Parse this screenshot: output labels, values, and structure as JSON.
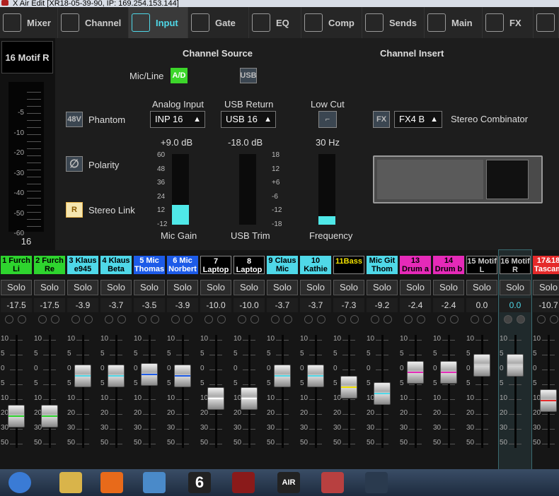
{
  "window": {
    "title": "X Air Edit [XR18-05-39-90, IP: 169.254.153.144]"
  },
  "tabs": [
    {
      "label": "Mixer",
      "icon": "mixer-icon"
    },
    {
      "label": "Channel",
      "icon": "channel-icon"
    },
    {
      "label": "Input",
      "icon": "input-icon",
      "active": true
    },
    {
      "label": "Gate",
      "icon": "gate-icon"
    },
    {
      "label": "EQ",
      "icon": "eq-icon"
    },
    {
      "label": "Comp",
      "icon": "comp-icon"
    },
    {
      "label": "Sends",
      "icon": "sends-icon"
    },
    {
      "label": "Main",
      "icon": "main-icon"
    },
    {
      "label": "FX",
      "icon": "fx-icon"
    },
    {
      "label": "",
      "icon": "more-icon"
    }
  ],
  "channel": {
    "name": "16  Motif R",
    "meter_number": "16",
    "meter_scale": [
      "-5",
      "-10",
      "-20",
      "-30",
      "-40",
      "-50",
      "-60"
    ]
  },
  "source": {
    "header": "Channel Source",
    "insert_header": "Channel Insert",
    "micline_label": "Mic/Line",
    "ad_label": "A/D",
    "usb_label": "USB",
    "phantom_btn": "48V",
    "phantom_label": "Phantom",
    "polarity_icon": "polarity-icon",
    "polarity_label": "Polarity",
    "stereolink_btn": "R",
    "stereolink_label": "Stereo Link",
    "analog_label": "Analog Input",
    "analog_value": "INP 16",
    "usbreturn_label": "USB Return",
    "usbreturn_value": "USB 16",
    "lowcut_label": "Low Cut",
    "gain_value": "+9.0 dB",
    "gain_label": "Mic Gain",
    "gain_scale": [
      "60",
      "48",
      "36",
      "24",
      "12",
      "-12"
    ],
    "gain_level": 0.28,
    "usbtrim_value": "-18.0 dB",
    "usbtrim_label": "USB Trim",
    "trim_scale": [
      "18",
      "12",
      "+6",
      "-6",
      "-12",
      "-18"
    ],
    "freq_value": "30 Hz",
    "freq_label": "Frequency",
    "freq_level": 0.12,
    "fx_btn": "FX",
    "fx_value": "FX4 B",
    "fx_name": "Stereo Combinator"
  },
  "fader_scale": [
    "10",
    "5",
    "0",
    "5",
    "10",
    "20",
    "30",
    "50"
  ],
  "strips": [
    {
      "name": "1 Furch Li",
      "color": "#2ed42e",
      "text_color": "#000",
      "value": "-17.5",
      "fader": 0.72,
      "stripe": "#2ed42e"
    },
    {
      "name": "2 Furch Re",
      "color": "#2ed42e",
      "text_color": "#000",
      "value": "-17.5",
      "fader": 0.72,
      "stripe": "#2ed42e"
    },
    {
      "name": "3 Klaus e945",
      "color": "#4fd8e8",
      "text_color": "#000",
      "value": "-3.9",
      "fader": 0.36,
      "stripe": "#4fd8e8"
    },
    {
      "name": "4 Klaus Beta",
      "color": "#4fd8e8",
      "text_color": "#000",
      "value": "-3.7",
      "fader": 0.36,
      "stripe": "#4fd8e8"
    },
    {
      "name": "5 Mic Thomas",
      "color": "#1d5be8",
      "text_color": "#fff",
      "value": "-3.5",
      "fader": 0.35,
      "stripe": "#1d5be8"
    },
    {
      "name": "6 Mic Norbert",
      "color": "#1d5be8",
      "text_color": "#fff",
      "value": "-3.9",
      "fader": 0.36,
      "stripe": "#1d5be8"
    },
    {
      "name": "7 Laptop Li",
      "color": "#000",
      "text_color": "#fff",
      "value": "-10.0",
      "fader": 0.56,
      "stripe": "#fff"
    },
    {
      "name": "8 Laptop Re",
      "color": "#000",
      "text_color": "#fff",
      "value": "-10.0",
      "fader": 0.56,
      "stripe": "#fff"
    },
    {
      "name": "9 Claus Mic",
      "color": "#4fd8e8",
      "text_color": "#000",
      "value": "-3.7",
      "fader": 0.36,
      "stripe": "#4fd8e8"
    },
    {
      "name": "10 Kathie",
      "color": "#4fd8e8",
      "text_color": "#000",
      "value": "-3.7",
      "fader": 0.36,
      "stripe": "#4fd8e8"
    },
    {
      "name": "11Bass",
      "color": "#000",
      "text_color": "#f0e000",
      "value": "-7.3",
      "fader": 0.46,
      "stripe": "#f0e000"
    },
    {
      "name": "Mic Git Thom",
      "color": "#4fd8e8",
      "text_color": "#000",
      "value": "-9.2",
      "fader": 0.52,
      "stripe": "#4fd8e8"
    },
    {
      "name": "13  Drum a",
      "color": "#e52ab8",
      "text_color": "#000",
      "value": "-2.4",
      "fader": 0.33,
      "stripe": "#e52ab8"
    },
    {
      "name": "14  Drum b",
      "color": "#e52ab8",
      "text_color": "#000",
      "value": "-2.4",
      "fader": 0.33,
      "stripe": "#e52ab8"
    },
    {
      "name": "15  Motif L",
      "color": "#000",
      "text_color": "#ccc",
      "value": "0.0",
      "fader": 0.27,
      "stripe": "#ccc"
    },
    {
      "name": "16  Motif R",
      "color": "#000",
      "text_color": "#ccc",
      "value": "0.0",
      "fader": 0.27,
      "stripe": "#ccc",
      "selected": true
    },
    {
      "name": "17&18 Tascam",
      "color": "#e52a2a",
      "text_color": "#fff",
      "value": "-10.7",
      "fader": 0.58,
      "stripe": "#e52a2a"
    }
  ],
  "strip_solo": "Solo",
  "taskbar": [
    {
      "icon": "start-orb-icon"
    },
    {
      "icon": "explorer-icon"
    },
    {
      "icon": "firefox-icon"
    },
    {
      "icon": "media-icon"
    },
    {
      "icon": "app6-icon",
      "label": "6"
    },
    {
      "icon": "cubase-icon"
    },
    {
      "icon": "xair-icon",
      "label": "AIR"
    },
    {
      "icon": "tools-icon"
    },
    {
      "icon": "xedit-icon"
    }
  ]
}
